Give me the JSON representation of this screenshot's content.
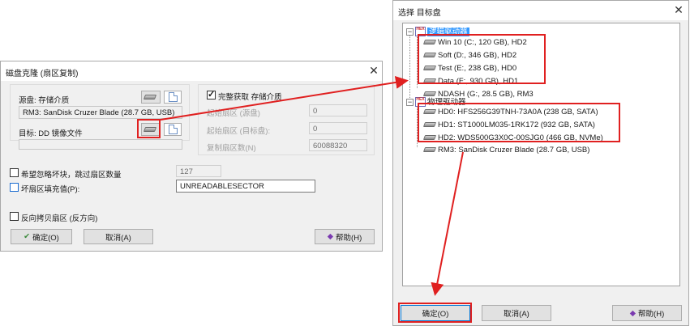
{
  "left_dialog": {
    "title": "磁盘克隆 (扇区复制)",
    "source_label": "源盘: 存储介质",
    "source_value": "RM3: SanDisk Cruzer Blade (28.7 GB, USB)",
    "target_label": "目标: DD 镜像文件",
    "target_value": "",
    "full_copy_label": "完整获取 存储介质",
    "start_sector_label": "起始扇区 (源盘)",
    "start_sector_value": "0",
    "start_sector_target_label": "起始扇区 (目标盘):",
    "start_sector_target_value": "0",
    "copy_count_label": "复制扇区数(N)",
    "copy_count_value": "60088320",
    "skip_bad_label": "希望忽略坏块，跳过扇区数量",
    "skip_bad_value": "127",
    "fill_bad_label": "坏扇区填充值(P):",
    "fill_bad_value": "UNREADABLESECTOR",
    "reverse_copy_label": "反向拷贝扇区 (反方向)",
    "ok_label": "确定(O)",
    "cancel_label": "取消(A)",
    "help_label": "帮助(H)"
  },
  "right_dialog": {
    "title": "选择 目标盘",
    "logical_group_label": "逻辑驱动器",
    "logical_drives": [
      "Win 10 (C:, 120 GB), HD2",
      "Soft (D:, 346 GB), HD2",
      "Test (E:, 238 GB), HD0",
      "Data (F:, 930 GB), HD1",
      "NDASH (G:, 28.5 GB), RM3"
    ],
    "physical_group_label": "物理驱动器",
    "physical_drives": [
      "HD0: HFS256G39TNH-73A0A (238 GB, SATA)",
      "HD1: ST1000LM035-1RK172 (932 GB, SATA)",
      "HD2: WDS500G3X0C-00SJG0 (466 GB, NVMe)",
      "RM3: SanDisk Cruzer Blade (28.7 GB, USB)"
    ],
    "ok_label": "确定(O)",
    "cancel_label": "取消(A)",
    "help_label": "帮助(H)"
  },
  "icons": {
    "hex_badge_text": "HEX",
    "close_glyph": "✕"
  },
  "colors": {
    "annotation_red": "#e02020",
    "selection_blue": "#3399ff",
    "dialog_bg": "#f0f0f0"
  }
}
